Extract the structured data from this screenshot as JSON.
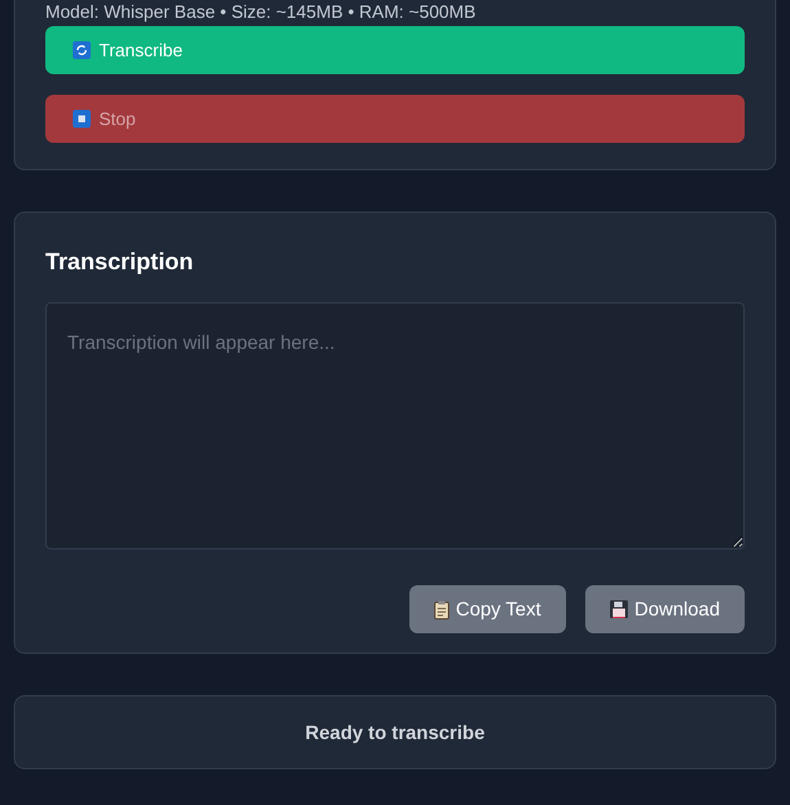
{
  "model_info": "Model: Whisper Base • Size: ~145MB • RAM: ~500MB",
  "actions": [
    {
      "kind": "transcribe",
      "label": "Transcribe",
      "disabled": false
    },
    {
      "kind": "stop",
      "label": "Stop",
      "disabled": true
    }
  ],
  "transcription": {
    "title": "Transcription",
    "placeholder": "Transcription will appear here...",
    "buttons": [
      {
        "kind": "copy",
        "label": "Copy Text"
      },
      {
        "kind": "download",
        "label": "Download"
      }
    ]
  },
  "status": "Ready to transcribe"
}
